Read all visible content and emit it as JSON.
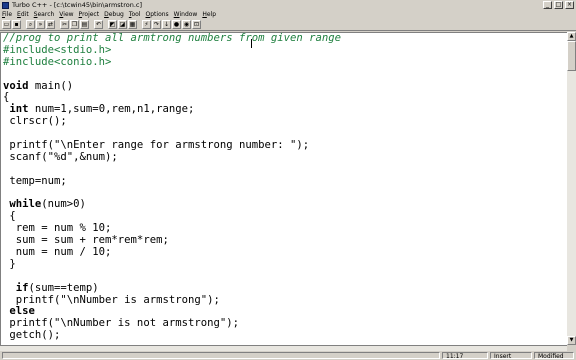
{
  "window": {
    "title": "Turbo C++ - [c:\\tcwin45\\bin\\armstron.c]",
    "controls": [
      "_",
      "□",
      "×"
    ]
  },
  "menu": [
    "File",
    "Edit",
    "Search",
    "View",
    "Project",
    "Debug",
    "Tool",
    "Options",
    "Window",
    "Help"
  ],
  "toolbar": [
    "open-icon",
    "save-icon",
    "search-icon",
    "search-next-icon",
    "replace-icon",
    "cut-icon",
    "copy-icon",
    "paste-icon",
    "undo-icon",
    "compile-icon",
    "make-icon",
    "build-icon",
    "run-icon",
    "step-icon",
    "trace-icon",
    "breakpoint-icon",
    "watch-icon",
    "inspect-icon"
  ],
  "editor": {
    "lines": [
      "//prog to print all armtrong numbers from given range",
      "#include<stdio.h>",
      "#include<conio.h>",
      "",
      "void main()",
      "{",
      " int num=1,sum=0,rem,n1,range;",
      " clrscr();",
      "",
      " printf(\"\\nEnter range for armstrong number: \");",
      " scanf(\"%d\",&num);",
      "",
      " temp=num;",
      "",
      " while(num>0)",
      " {",
      "  rem = num % 10;",
      "  sum = sum + rem*rem*rem;",
      "  num = num / 10;",
      " }",
      "",
      "  if(sum==temp)",
      "  printf(\"\\nNumber is armstrong\");",
      " else",
      " printf(\"\\nNumber is not armstrong\");",
      " getch();"
    ]
  },
  "status": {
    "position": "11:17",
    "mode": "Insert",
    "modified": "Modified"
  }
}
